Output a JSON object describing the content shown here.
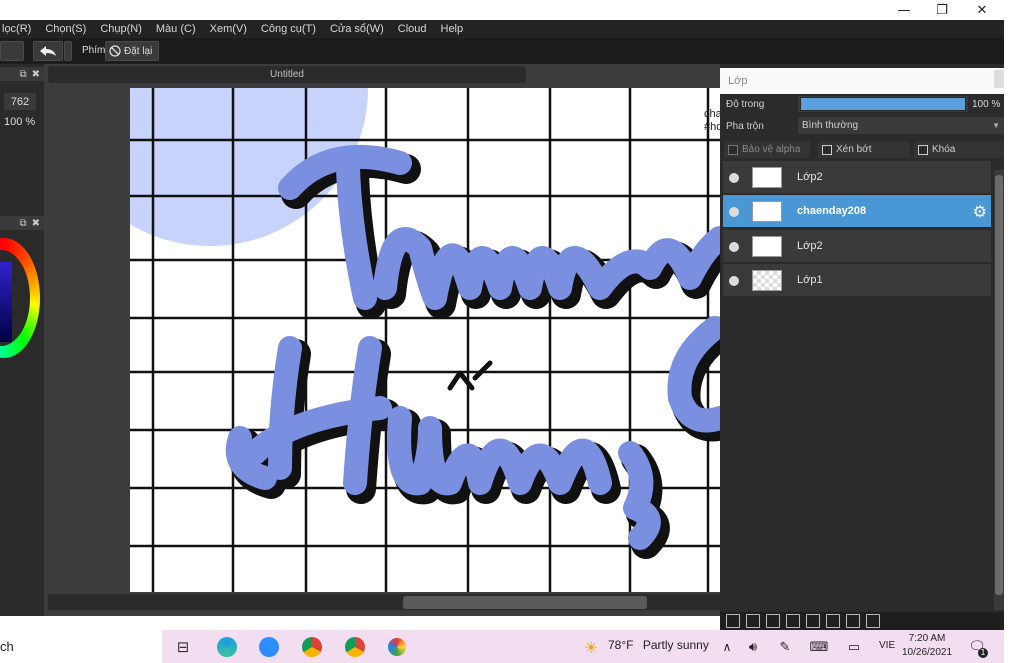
{
  "window": {
    "minimize_glyph": "—",
    "restore_glyph": "❐",
    "close_glyph": "✕"
  },
  "menu": {
    "items": [
      "lọc(R)",
      "Chọn(S)",
      "Chụp(N)",
      "Màu (C)",
      "Xem(V)",
      "Công cụ(T)",
      "Cửa sổ(W)",
      "Cloud",
      "Help"
    ]
  },
  "toolbar": {
    "shortcut_label": "Phím",
    "reset_label": "Đặt lại"
  },
  "left_panel": {
    "zoom_value": "762",
    "zoom_percent": "100 %"
  },
  "document": {
    "tab_title": "Untitled",
    "side_text_1": "cha",
    "side_text_2": "#hơ"
  },
  "layer_panel": {
    "title": "Lớp",
    "opacity_label": "Độ trong",
    "opacity_value": "100 %",
    "opacity_fraction": 1.0,
    "blend_label": "Pha trộn",
    "blend_value": "Bình thường",
    "protect_alpha_label": "Bảo vệ alpha",
    "clipping_label": "Xén bớt",
    "lock_label": "Khóa",
    "layers": [
      {
        "name": "Lớp2",
        "active": false
      },
      {
        "name": "chaenday208",
        "active": true
      },
      {
        "name": "Lớp2",
        "active": false
      },
      {
        "name": "Lớp1",
        "active": false
      }
    ]
  },
  "taskbar": {
    "search_fragment": "ch",
    "weather_temp": "78°F",
    "weather_text": "Partly sunny",
    "language": "VIE",
    "time": "7:20 AM",
    "date": "10/26/2021",
    "notification_count": "1"
  },
  "colors": {
    "accent": "#4a97d6",
    "lettering": "#7b8fe0",
    "circle": "#c7d3fb",
    "taskbar": "#f2def0"
  }
}
